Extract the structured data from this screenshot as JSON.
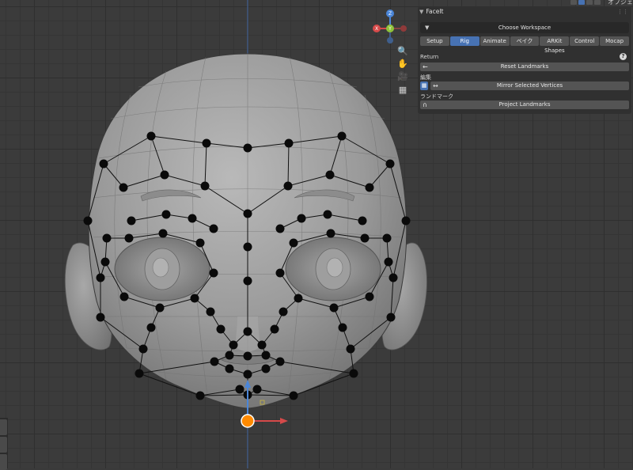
{
  "header": {
    "menu_label": "オブジェク"
  },
  "panel": {
    "title": "FaceIt",
    "choose_workspace": "Choose Workspace",
    "tabs": [
      {
        "label": "Setup",
        "active": false
      },
      {
        "label": "Rig",
        "active": true
      },
      {
        "label": "Animate",
        "active": false
      },
      {
        "label": "ベイク",
        "active": false
      },
      {
        "label": "ARKit Shapes",
        "active": false
      },
      {
        "label": "Control",
        "active": false
      },
      {
        "label": "Mocap",
        "active": false
      }
    ],
    "return_label": "Return",
    "reset_landmarks": "Reset Landmarks",
    "edit_label": "編集",
    "mirror_selected": "Mirror Selected Vertices",
    "landmarks_label": "ランドマーク",
    "project_landmarks": "Project Landmarks"
  },
  "gizmo": {
    "axes": [
      {
        "name": "Z",
        "color": "#4b86d8"
      },
      {
        "name": "X",
        "color": "#d64a4a"
      },
      {
        "name": "Y",
        "color": "#8fc23a"
      }
    ]
  },
  "nav_icons": [
    "zoom-icon",
    "hand-pan-icon",
    "camera-icon",
    "grid-toggle-icon"
  ],
  "colors": {
    "accent": "#4772b3",
    "panel_bg": "#303030",
    "button_bg": "#545454",
    "landmark": "#0a0a0a",
    "origin": "#ff8a00"
  }
}
